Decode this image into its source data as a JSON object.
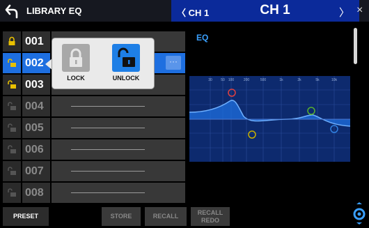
{
  "header": {
    "title": "LIBRARY EQ",
    "channel_prev": "〈 CH 1",
    "channel_current": "CH 1",
    "channel_next": "〉",
    "close": "×"
  },
  "library": {
    "rows": [
      {
        "number": "001",
        "locked": true,
        "empty": false
      },
      {
        "number": "002",
        "locked": false,
        "empty": false,
        "selected": true
      },
      {
        "number": "003",
        "locked": false,
        "empty": false
      },
      {
        "number": "004",
        "locked": false,
        "empty": true
      },
      {
        "number": "005",
        "locked": false,
        "empty": true
      },
      {
        "number": "006",
        "locked": false,
        "empty": true
      },
      {
        "number": "007",
        "locked": false,
        "empty": true
      },
      {
        "number": "008",
        "locked": false,
        "empty": true
      }
    ],
    "more_label": "···"
  },
  "popup": {
    "lock_label": "LOCK",
    "unlock_label": "UNLOCK"
  },
  "toolbar": {
    "preset_label": "PRESET",
    "store_label": "STORE",
    "recall_label": "RECALL",
    "recall_redo_line1": "RECALL",
    "recall_redo_line2": "REDO"
  },
  "eq": {
    "label": "EQ",
    "freq_ticks": [
      "30",
      "50",
      "100",
      "200",
      "500",
      "1k",
      "2k",
      "5k",
      "10k"
    ],
    "band_colors": [
      "#e04040",
      "#c8b000",
      "#58b030",
      "#3080e0"
    ],
    "accent_color": "#1e6fe0"
  }
}
